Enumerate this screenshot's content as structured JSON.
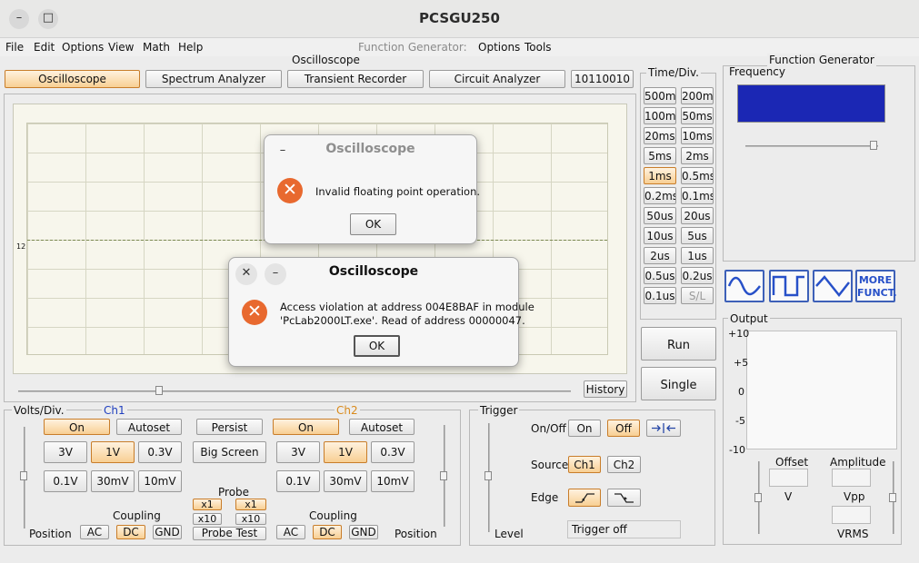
{
  "window": {
    "title": "PCSGU250"
  },
  "menu": {
    "file": "File",
    "edit": "Edit",
    "options": "Options",
    "view": "View",
    "math": "Math",
    "help": "Help",
    "fg_label": "Function Generator:",
    "fg_options": "Options",
    "fg_tools": "Tools"
  },
  "tabs": {
    "group": "Oscilloscope",
    "oscilloscope": "Oscilloscope",
    "spectrum": "Spectrum Analyzer",
    "transient": "Transient Recorder",
    "circuit": "Circuit Analyzer",
    "binary": "10110010"
  },
  "screen": {
    "level_marker": "12",
    "history": "History"
  },
  "timediv": {
    "label": "Time/Div.",
    "rows": [
      [
        "500ms",
        "200ms"
      ],
      [
        "100ms",
        "50ms"
      ],
      [
        "20ms",
        "10ms"
      ],
      [
        "5ms",
        "2ms"
      ],
      [
        "1ms",
        "0.5ms"
      ],
      [
        "0.2ms",
        "0.1ms"
      ],
      [
        "50us",
        "20us"
      ],
      [
        "10us",
        "5us"
      ],
      [
        "2us",
        "1us"
      ],
      [
        "0.5us",
        "0.2us"
      ],
      [
        "0.1us",
        "S/L"
      ]
    ],
    "selected": "1ms",
    "run": "Run",
    "single": "Single"
  },
  "volts": {
    "label": "Volts/Div.",
    "ch1": "Ch1",
    "ch2": "Ch2",
    "ch1_color": "#1f3fbf",
    "ch2_color": "#d98a1c",
    "on": "On",
    "autoset": "Autoset",
    "persist": "Persist",
    "big_screen": "Big Screen",
    "ranges_top": [
      "3V",
      "1V",
      "0.3V"
    ],
    "ranges_bottom": [
      "0.1V",
      "30mV",
      "10mV"
    ],
    "selected": "1V",
    "probe": "Probe",
    "x1": "x1",
    "x10": "x10",
    "probe_test": "Probe Test",
    "coupling": "Coupling",
    "ac": "AC",
    "dc": "DC",
    "gnd": "GND",
    "position": "Position"
  },
  "trigger": {
    "label": "Trigger",
    "onoff": "On/Off",
    "on": "On",
    "off": "Off",
    "source": "Source",
    "ch1": "Ch1",
    "ch2": "Ch2",
    "edge": "Edge",
    "level": "Level",
    "status": "Trigger off"
  },
  "function_generator": {
    "label": "Function Generator",
    "frequency": "Frequency",
    "frequency_color": "#1b27b4",
    "more_line1": "MORE",
    "more_line2": "FUNCT.",
    "output": "Output",
    "scale": [
      "+10",
      "+5",
      "0",
      "-5",
      "-10"
    ],
    "offset": "Offset",
    "offset_unit": "V",
    "amplitude": "Amplitude",
    "vpp": "Vpp",
    "vrms": "VRMS"
  },
  "dialog1": {
    "title": "Oscilloscope",
    "message": "Invalid floating point operation.",
    "ok": "OK"
  },
  "dialog2": {
    "title": "Oscilloscope",
    "message_line1": "Access violation at address 004E8BAF in module",
    "message_line2": "'PcLab2000LT.exe'. Read of address 00000047.",
    "ok": "OK"
  }
}
